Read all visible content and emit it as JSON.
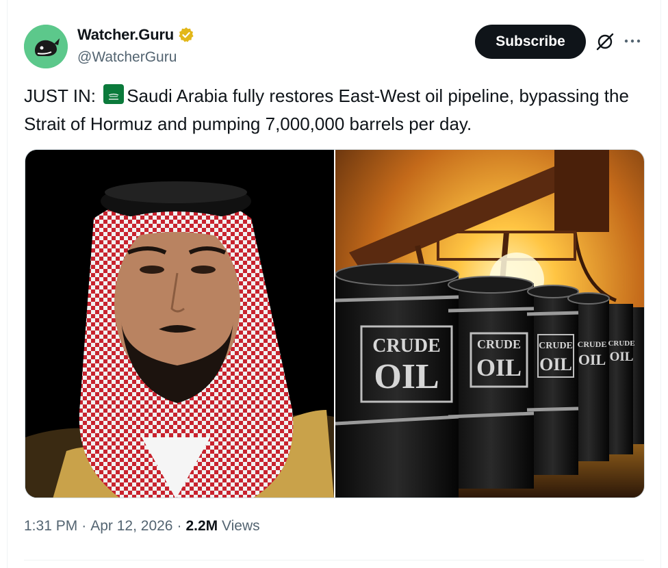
{
  "author": {
    "display_name": "Watcher.Guru",
    "handle": "@WatcherGuru",
    "verified_badge_color": "#e2b719",
    "avatar_color": "#5cc88b",
    "avatar_icon": "whale-logo-icon"
  },
  "actions": {
    "subscribe_label": "Subscribe",
    "grok_icon": "grok-icon",
    "more_icon": "more-icon"
  },
  "tweet": {
    "text_prefix": "JUST IN:",
    "flag_icon": "saudi-arabia-flag-icon",
    "text_body": "Saudi Arabia fully restores East-West oil pipeline, bypassing the Strait of Hormuz and pumping 7,000,000 barrels per day."
  },
  "media": {
    "images": [
      {
        "name": "portrait-photo"
      },
      {
        "name": "oil-barrels-photo",
        "barrel_label_line1": "CRUDE",
        "barrel_label_line2": "OIL"
      }
    ]
  },
  "meta": {
    "time": "1:31 PM",
    "date": "Apr 12, 2026",
    "views_count": "2.2M",
    "views_label": "Views",
    "separator": "·"
  }
}
